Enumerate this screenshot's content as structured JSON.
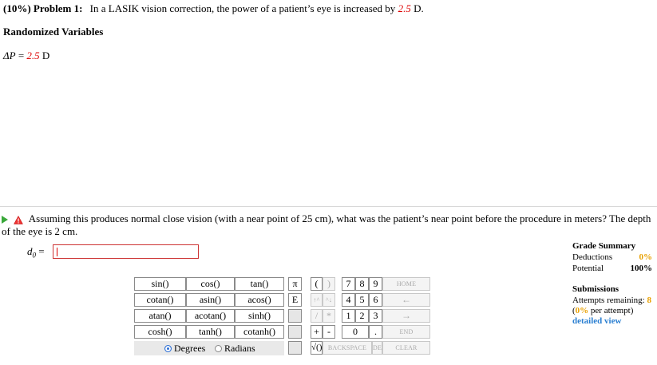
{
  "problem": {
    "label": "(10%) Problem 1:",
    "text_before": "In a LASIK vision correction, the power of a patient’s eye is increased by",
    "value": "2.5",
    "text_after": "D."
  },
  "randomized": {
    "heading": "Randomized Variables",
    "var_name": "ΔP",
    "eq": " = ",
    "value": "2.5",
    "unit": "D"
  },
  "question": {
    "text": "Assuming this produces normal close vision (with a near point of 25 cm), what was the patient’s near point before the procedure in meters? The depth of the eye is 2 cm."
  },
  "answer": {
    "label": "d",
    "label_sub": "0",
    "eq": " = ",
    "value": ""
  },
  "calculator": {
    "functions": [
      [
        "sin()",
        "cos()",
        "tan()"
      ],
      [
        "cotan()",
        "asin()",
        "acos()"
      ],
      [
        "atan()",
        "acotan()",
        "sinh()"
      ],
      [
        "cosh()",
        "tanh()",
        "cotanh()"
      ]
    ],
    "pi": "π",
    "lparen": "(",
    "rparen": ")",
    "e": "E",
    "up": "↑^",
    "caret": "^↓",
    "slash": "/",
    "star": "*",
    "plus": "+",
    "minus": "-",
    "sqrt": "√()",
    "digits": [
      "7",
      "8",
      "9",
      "4",
      "5",
      "6",
      "1",
      "2",
      "3",
      "0",
      "."
    ],
    "home": "HOME",
    "left": "←",
    "right": "→",
    "end": "END",
    "backspace": "BACKSPACE",
    "del": "DEL",
    "clear": "CLEAR",
    "degrees": "Degrees",
    "radians": "Radians",
    "selected_mode": "Degrees"
  },
  "grade_summary": {
    "title": "Grade Summary",
    "deductions_label": "Deductions",
    "deductions_value": "0%",
    "potential_label": "Potential",
    "potential_value": "100%",
    "submissions_title": "Submissions",
    "attempts_label": "Attempts remaining:",
    "attempts_value": "8",
    "per_attempt_pct": "0%",
    "per_attempt_text": "per attempt)",
    "detailed_view": "detailed view"
  },
  "colors": {
    "accent_red": "#dd0000",
    "link_blue": "#2a7fd1",
    "orange": "#e8a000",
    "play_green": "#3aa83a"
  }
}
